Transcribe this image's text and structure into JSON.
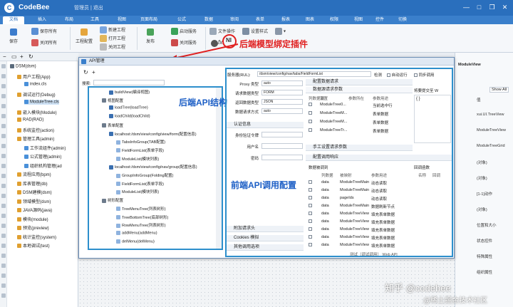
{
  "app": {
    "title": "CodeBee",
    "user": "管理员 | 退出"
  },
  "menu_tabs": [
    "文档",
    "插入",
    "布局",
    "工具",
    "视图",
    "页面布局",
    "公式",
    "数据",
    "审阅",
    "表单",
    "报表",
    "图表",
    "权限",
    "视图",
    "控件",
    "切换"
  ],
  "ribbon": {
    "save": "保存",
    "save_as": "保存所有",
    "close_all": "关闭所有",
    "workspace": "工程配置",
    "new_project": "新建工程",
    "open_project": "打开工程",
    "close_project": "关闭工程",
    "publish": "发布",
    "start_server": "启动服务",
    "stop_server": "关闭服务",
    "file_ops": "文件操作",
    "set_style": "设置样式",
    "fx": "fx"
  },
  "annotations": {
    "backend_plugin": "后端模型绑定插件",
    "backend_api_structure": "后端API结构",
    "frontend_api_config": "前端API调用配置"
  },
  "left_tree": {
    "nodes": [
      {
        "label": "DSM(dsm)",
        "level": 0,
        "color": "#5b6b7c"
      },
      {
        "label": "用户工程(App)",
        "level": 1,
        "color": "#e0a030"
      },
      {
        "label": "index.cls",
        "level": 2,
        "color": "#4a90d9"
      },
      {
        "label": "调试运行(Debug)",
        "level": 1,
        "color": "#e0a030"
      },
      {
        "label": "ModuleTree.cls",
        "level": 2,
        "color": "#4a90d9"
      },
      {
        "label": "嵌入模块(Module)",
        "level": 1,
        "color": "#e0a030"
      },
      {
        "label": "RAD(RAD)",
        "level": 1,
        "color": "#e0a030"
      },
      {
        "label": "系统监控(action)",
        "level": 1,
        "color": "#e0a030"
      },
      {
        "label": "管理工具(admin)",
        "level": 1,
        "color": "#e0a030"
      },
      {
        "label": "工作流组件(admin)",
        "level": 2,
        "color": "#4a90d9"
      },
      {
        "label": "公式管理(admin)",
        "level": 2,
        "color": "#4a90d9"
      },
      {
        "label": "组织机构管理(ad",
        "level": 2,
        "color": "#4a90d9"
      },
      {
        "label": "流程应用(bpm)",
        "level": 1,
        "color": "#e0a030"
      },
      {
        "label": "库表管理(db)",
        "level": 1,
        "color": "#e0a030"
      },
      {
        "label": "DSM建模(dsm)",
        "level": 1,
        "color": "#e0a030"
      },
      {
        "label": "领域模型(dsm)",
        "level": 1,
        "color": "#e0a030"
      },
      {
        "label": "JAVA源码(java)",
        "level": 1,
        "color": "#e0a030"
      },
      {
        "label": "模块(module)",
        "level": 1,
        "color": "#e0a030"
      },
      {
        "label": "预览(preview)",
        "level": 1,
        "color": "#e0a030"
      },
      {
        "label": "统计监控(system)",
        "level": 1,
        "color": "#e0a030"
      },
      {
        "label": "本地调试(test)",
        "level": 1,
        "color": "#e0a030"
      }
    ]
  },
  "dialog": {
    "title": "API管理",
    "search_label": "搜索:",
    "api_tree": [
      {
        "label": "buildView(编译视图)",
        "level": 2
      },
      {
        "label": "视图配置",
        "level": 1
      },
      {
        "label": "loadTree(loadTree)",
        "level": 2
      },
      {
        "label": "loadChild(loadChild)",
        "level": 2
      },
      {
        "label": "表单配置",
        "level": 1
      },
      {
        "label": "localhost:/dsm/view/config/view/form(配置信息)",
        "level": 2
      },
      {
        "label": "TabsInfoGroup(TAB配置)",
        "level": 3
      },
      {
        "label": "FieldFormList(表单字段)",
        "level": 3
      },
      {
        "label": "ModuleList(模块列表)",
        "level": 3
      },
      {
        "label": "localhost:/dsm/view/config/nav/group(配置信息)",
        "level": 2
      },
      {
        "label": "GroupInfoGroup(Folding配置)",
        "level": 3
      },
      {
        "label": "FieldFormList(表单字段)",
        "level": 3
      },
      {
        "label": "ModuleList(模块列表)",
        "level": 3
      },
      {
        "label": "树形配置",
        "level": 1
      },
      {
        "label": "TreeMenuTree(列表树形)",
        "level": 3
      },
      {
        "label": "TreeBottomTree(底部树形)",
        "level": 3
      },
      {
        "label": "RowMenuTree(列表树形)",
        "level": 3
      },
      {
        "label": "addMenu(addMenu)",
        "level": 3
      },
      {
        "label": "delMenu(delMenu)",
        "level": 3
      }
    ],
    "url_label": "服务器(RUL):",
    "url_value": "/dsm/view/config/nav/tabs/FieldFormList",
    "check_label": "检测",
    "auto_run": "自动运行",
    "sync_call": "同步调用",
    "form_rows": [
      {
        "label": "Proxy 类型",
        "value": "auto"
      },
      {
        "label": "请求数据类型",
        "value": "FORM"
      },
      {
        "label": "返回数据类型",
        "value": "JSON"
      },
      {
        "label": "数据请求方式",
        "value": "auto"
      }
    ],
    "auth_section": "认证信息",
    "auth_rows": [
      {
        "label": "身份验证令牌"
      },
      {
        "label": "用户名"
      },
      {
        "label": "密码"
      }
    ],
    "attach_header": "附加请求头",
    "cookies": "Cookies 模拟",
    "other_options": "其他调用选项",
    "req_section": "配置数据请求",
    "req_params": "数据源请求参数",
    "req_cols": [
      "列数据源",
      "设置",
      "参数所在",
      "参数用途"
    ],
    "req_rows": [
      [
        "ModuleTree0...",
        "",
        "当前选中行"
      ],
      [
        "ModuleTreeM...",
        "",
        "表单数据"
      ],
      [
        "ModuleTreeM...",
        "",
        "表单数据"
      ],
      [
        "ModuleTreeTr...",
        "",
        "表单数据"
      ]
    ],
    "manual_params": "手工设置请求参数",
    "call_section": "配置调用响应",
    "data_binding": "数据被调到",
    "bind_cols": [
      "列数据",
      "被映射",
      "参数用途"
    ],
    "bind_rows": [
      [
        "data",
        "ModuleTreeMain",
        "动态读取"
      ],
      [
        "data",
        "ModuleTreeMain",
        "动态读取"
      ],
      [
        "data",
        "pageIds",
        "动态读取"
      ],
      [
        "data",
        "ModuleTreeMain",
        "数据刷新节点"
      ],
      [
        "data",
        "ModuleTreeView",
        "填充表单数据"
      ],
      [
        "data",
        "ModuleTreeView",
        "填充表单数据"
      ],
      [
        "data",
        "ModuleTreeView",
        "填充表单数据"
      ],
      [
        "data",
        "ModuleTreeView",
        "填充表单数据"
      ],
      [
        "data",
        "ModuleTreeView",
        "填充表单数据"
      ]
    ],
    "callback_label": "回调函数",
    "callback_cols": [
      "名称",
      "回调"
    ],
    "value_label": "将要提交至 W",
    "value_text": "{ }",
    "footer": "测试（调试调用）  Web API"
  },
  "right_panel": {
    "title": "ModuleView",
    "show_all": "Show All",
    "rows": [
      {
        "k": "值",
        "v": ""
      },
      {
        "k": "",
        "v": "xui.UI.TreeView"
      },
      {
        "k": "",
        "v": "ModuleTreeView"
      },
      {
        "k": "",
        "v": "ModuleTreeGrid"
      },
      {
        "k": "",
        "v": "(对象)"
      },
      {
        "k": "",
        "v": "(对象)"
      },
      {
        "k": "",
        "v": "[1-1]动作"
      },
      {
        "k": "",
        "v": "(对象)"
      },
      {
        "k": "",
        "v": "位置和大小"
      },
      {
        "k": "",
        "v": "状态控件"
      },
      {
        "k": "",
        "v": "特殊属性"
      },
      {
        "k": "",
        "v": "组织属性"
      }
    ]
  },
  "watermark": {
    "line1": "知乎 @codebee",
    "line2": "@稀土掘金技术社区"
  }
}
